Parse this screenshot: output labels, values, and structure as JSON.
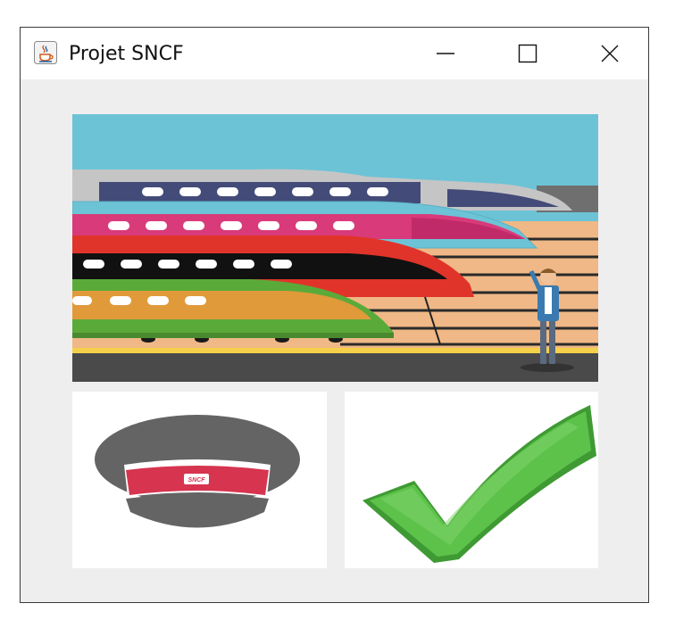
{
  "window": {
    "title": "Projet SNCF",
    "icon": "java-coffee-cup-icon",
    "controls": {
      "minimize_icon": "minimize-icon",
      "maximize_icon": "maximize-icon",
      "close_icon": "close-icon"
    }
  },
  "images": {
    "trains": {
      "name": "trains-illustration"
    },
    "cap": {
      "name": "sncf-cap-image",
      "badge_text": "SNCF"
    },
    "check": {
      "name": "green-checkmark-image"
    }
  },
  "colors": {
    "background": "#eeeeee",
    "sky": "#6cc3d6",
    "train_red": "#e0342a",
    "train_pink": "#d93a7a",
    "train_green": "#5aaa3a",
    "cap_band": "#d6344f",
    "cap_grey": "#646464",
    "check_green": "#4cae3a"
  }
}
